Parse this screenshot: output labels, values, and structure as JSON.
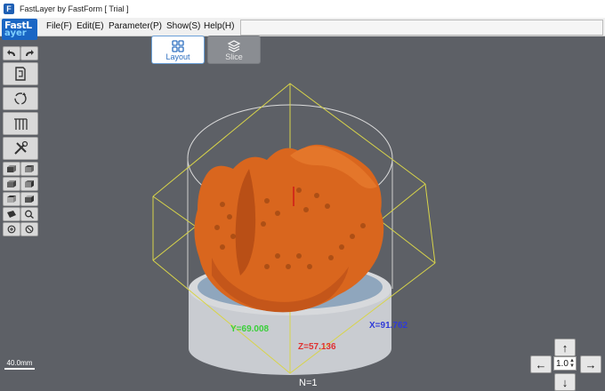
{
  "window": {
    "title": "FastLayer by FastForm [ Trial ]"
  },
  "logo": {
    "line1": "FastL",
    "line2": "ayer"
  },
  "menu": [
    {
      "label": "File(F)"
    },
    {
      "label": "Edit(E)"
    },
    {
      "label": "Parameter(P)"
    },
    {
      "label": "Show(S)"
    },
    {
      "label": "Help(H)"
    }
  ],
  "tabs": {
    "layout": "Layout",
    "slice": "Slice"
  },
  "viewport": {
    "coord_x": "X=91.762",
    "coord_y": "Y=69.008",
    "coord_z": "Z=57.136",
    "layer_count": "N=1",
    "scale_label": "40.0mm"
  },
  "nav": {
    "zoom": "1.0",
    "up": "↑",
    "down": "↓",
    "left": "←",
    "right": "→"
  },
  "colors": {
    "background": "#5d6066",
    "part": "#d9661e",
    "bbox": "#d8d44a",
    "platform": "#8fa6bd",
    "accent": "#2d6fc0"
  }
}
